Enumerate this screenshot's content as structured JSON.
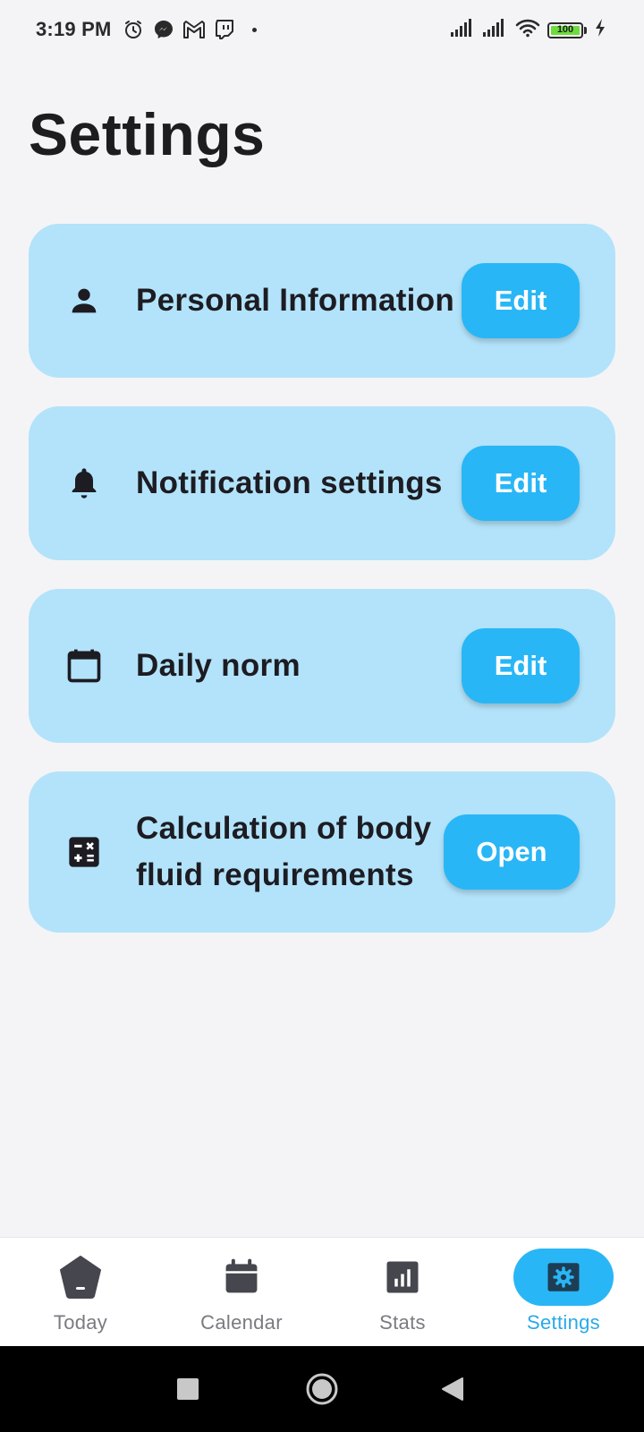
{
  "status_bar": {
    "time": "3:19 PM",
    "left_icons": [
      "alarm-icon",
      "messenger-icon",
      "gmail-icon",
      "twitch-icon"
    ],
    "right_icons": [
      "cell-signal-icon",
      "cell-signal-icon",
      "wifi-icon",
      "battery-icon",
      "charging-icon"
    ],
    "battery_level": "100"
  },
  "page": {
    "title": "Settings"
  },
  "settings_items": [
    {
      "icon": "person-icon",
      "label": "Personal Information",
      "button": "Edit"
    },
    {
      "icon": "bell-icon",
      "label": "Notification settings",
      "button": "Edit"
    },
    {
      "icon": "calendar-icon",
      "label": "Daily norm",
      "button": "Edit"
    },
    {
      "icon": "calculator-icon",
      "label": "Calculation of body fluid requirements",
      "button": "Open"
    }
  ],
  "bottom_nav": {
    "items": [
      {
        "icon": "today-icon",
        "label": "Today"
      },
      {
        "icon": "calendar-icon",
        "label": "Calendar"
      },
      {
        "icon": "stats-icon",
        "label": "Stats"
      },
      {
        "icon": "gear-icon",
        "label": "Settings"
      }
    ],
    "active_index": 3
  },
  "system_nav": {
    "icons": [
      "recents-icon",
      "home-icon",
      "back-icon"
    ]
  },
  "colors": {
    "background": "#f4f4f6",
    "card": "#b3e3fa",
    "accent": "#29b6f6",
    "text": "#1c1c22"
  }
}
